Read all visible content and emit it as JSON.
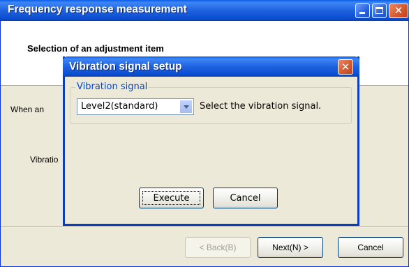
{
  "main_window": {
    "title": "Frequency response measurement",
    "header_title": "Selection of an adjustment item",
    "body_text_1": "When an",
    "body_text_2": "Vibratio",
    "back_label": "< Back(B)",
    "next_label": "Next(N) >",
    "cancel_label": "Cancel"
  },
  "dialog": {
    "title": "Vibration signal setup",
    "group_label": "Vibration signal",
    "selected_value": "Level2(standard)",
    "hint": "Select the vibration signal.",
    "execute_label": "Execute",
    "cancel_label": "Cancel"
  },
  "colors": {
    "titlebar": "#0a5ee8",
    "close_button": "#d65a2f",
    "window_face": "#ece9d8",
    "group_label": "#0046d5"
  },
  "icons": {
    "minimize": "minimize-icon",
    "maximize": "maximize-icon",
    "close": "close-icon",
    "dropdown": "chevron-down-icon"
  }
}
